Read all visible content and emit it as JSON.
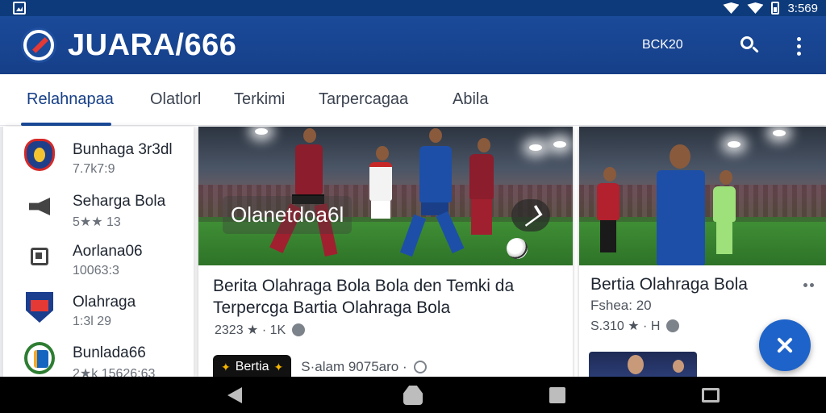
{
  "status_bar": {
    "time": "3:569",
    "icons": [
      "image-icon",
      "wifi-icon",
      "signal-icon",
      "battery-icon"
    ]
  },
  "app_bar": {
    "title": "JUARA/666",
    "secondary_text": "BCK20",
    "icons": [
      "logo-icon",
      "search-icon",
      "more-vert-icon"
    ],
    "color": "#1a4a9a"
  },
  "tabs": [
    {
      "label": "Relahnapaa",
      "active": true
    },
    {
      "label": "Olatlorl",
      "active": false
    },
    {
      "label": "Terkimi",
      "active": false
    },
    {
      "label": "Tarpercagaa",
      "active": false
    },
    {
      "label": "Abila",
      "active": false
    }
  ],
  "sidebar": {
    "items": [
      {
        "title": "Bunhaga 3r3dl",
        "meta": "7.7k7:9",
        "icon": "team-crest-icon"
      },
      {
        "title": "Seharga Bola",
        "meta": "5★★ 13",
        "icon": "megaphone-icon"
      },
      {
        "title": "Aorlana06",
        "meta": "10063:3",
        "icon": "square-icon"
      },
      {
        "title": "Olahraga",
        "meta": "1:3l 29",
        "icon": "shield-icon"
      },
      {
        "title": "Bunlada66",
        "meta": "2★k 15626:63",
        "icon": "green-crest-icon"
      }
    ]
  },
  "main_card": {
    "overlay_label": "Olanetdoa6l",
    "title": "Berita Olahraga Bola Bola den Temki da Terpercga Bartia Olahraga Bola",
    "meta": "2323 ★ · 1K",
    "badge": "Bertia",
    "bottom_text": "S·alam 9075aro ·"
  },
  "side_card": {
    "title": "Bertia Olahraga Bola",
    "subtitle": "Fshea: 20",
    "meta": "S.310 ★ · H"
  },
  "fab": {
    "icon": "close-icon",
    "color": "#1e63c9"
  },
  "nav_bar": {
    "icons": [
      "back-icon",
      "home-icon",
      "recents-icon",
      "rotate-icon"
    ]
  }
}
